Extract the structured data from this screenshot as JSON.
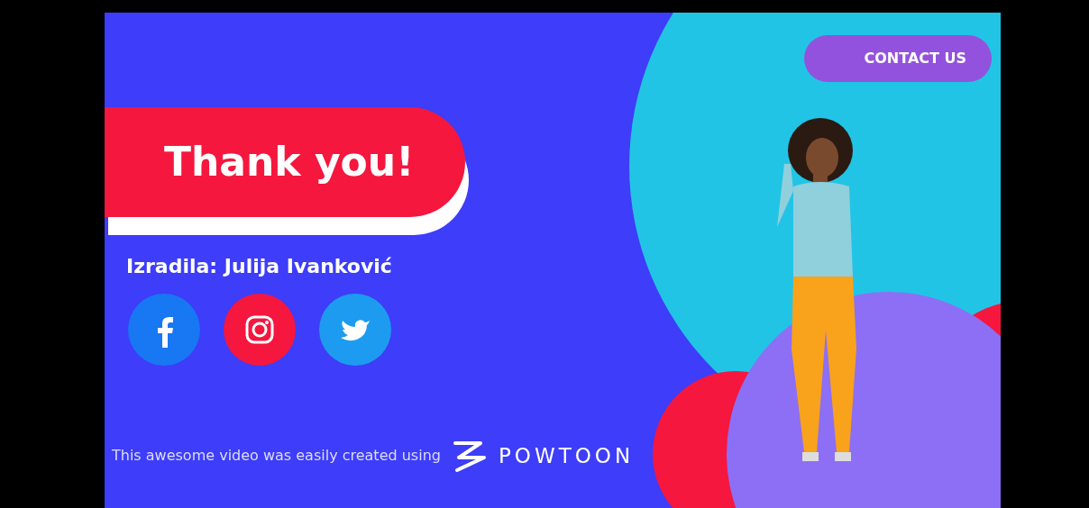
{
  "contact_button": {
    "label": "CONTACT US"
  },
  "title": "Thank you!",
  "author": "Izradila: Julija Ivanković",
  "social_links": [
    {
      "kind": "facebook",
      "color": "#1877f2"
    },
    {
      "kind": "instagram",
      "color": "#f5173e"
    },
    {
      "kind": "twitter",
      "color": "#1d9bf0"
    }
  ],
  "footer": {
    "text": "This awesome video was easily created using",
    "brand": "POWTOON"
  }
}
